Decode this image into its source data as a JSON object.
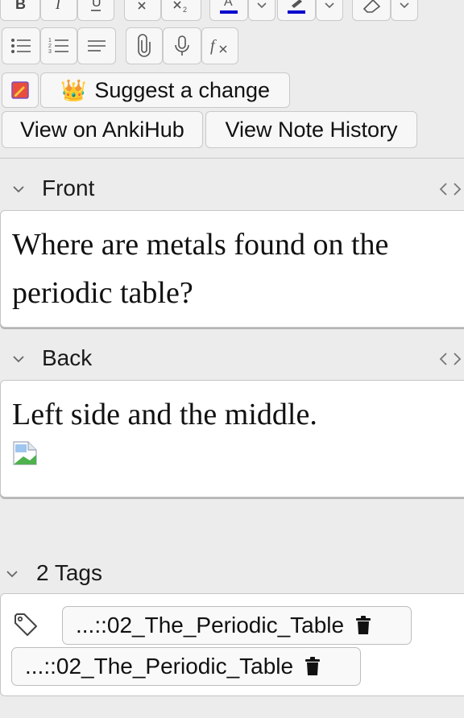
{
  "toolbar": {
    "row1": [
      "bold-icon",
      "italic-icon",
      "underline-icon",
      "superscript-icon",
      "subscript-icon",
      "text-color-icon",
      "dropdown-icon",
      "highlight-icon",
      "dropdown-icon",
      "eraser-icon",
      "dropdown-icon"
    ],
    "row2": [
      "bullet-list-icon",
      "numbered-list-icon",
      "align-icon",
      "attach-icon",
      "microphone-icon",
      "function-icon"
    ],
    "suggest_label": "Suggest a change",
    "suggest_emoji": "👑",
    "view_ankihub_label": "View on AnkiHub",
    "view_history_label": "View Note History",
    "text_color": "#0000cc",
    "highlight_color": "#0000cc"
  },
  "fields": [
    {
      "label": "Front",
      "content_lines": [
        "Where are metals found on the",
        "periodic table?"
      ]
    },
    {
      "label": "Back",
      "content_lines": [
        "Left side and the middle."
      ],
      "has_image": true
    }
  ],
  "tags": {
    "header": "2 Tags",
    "items": [
      "...::02_The_Periodic_Table",
      "...::02_The_Periodic_Table"
    ]
  }
}
